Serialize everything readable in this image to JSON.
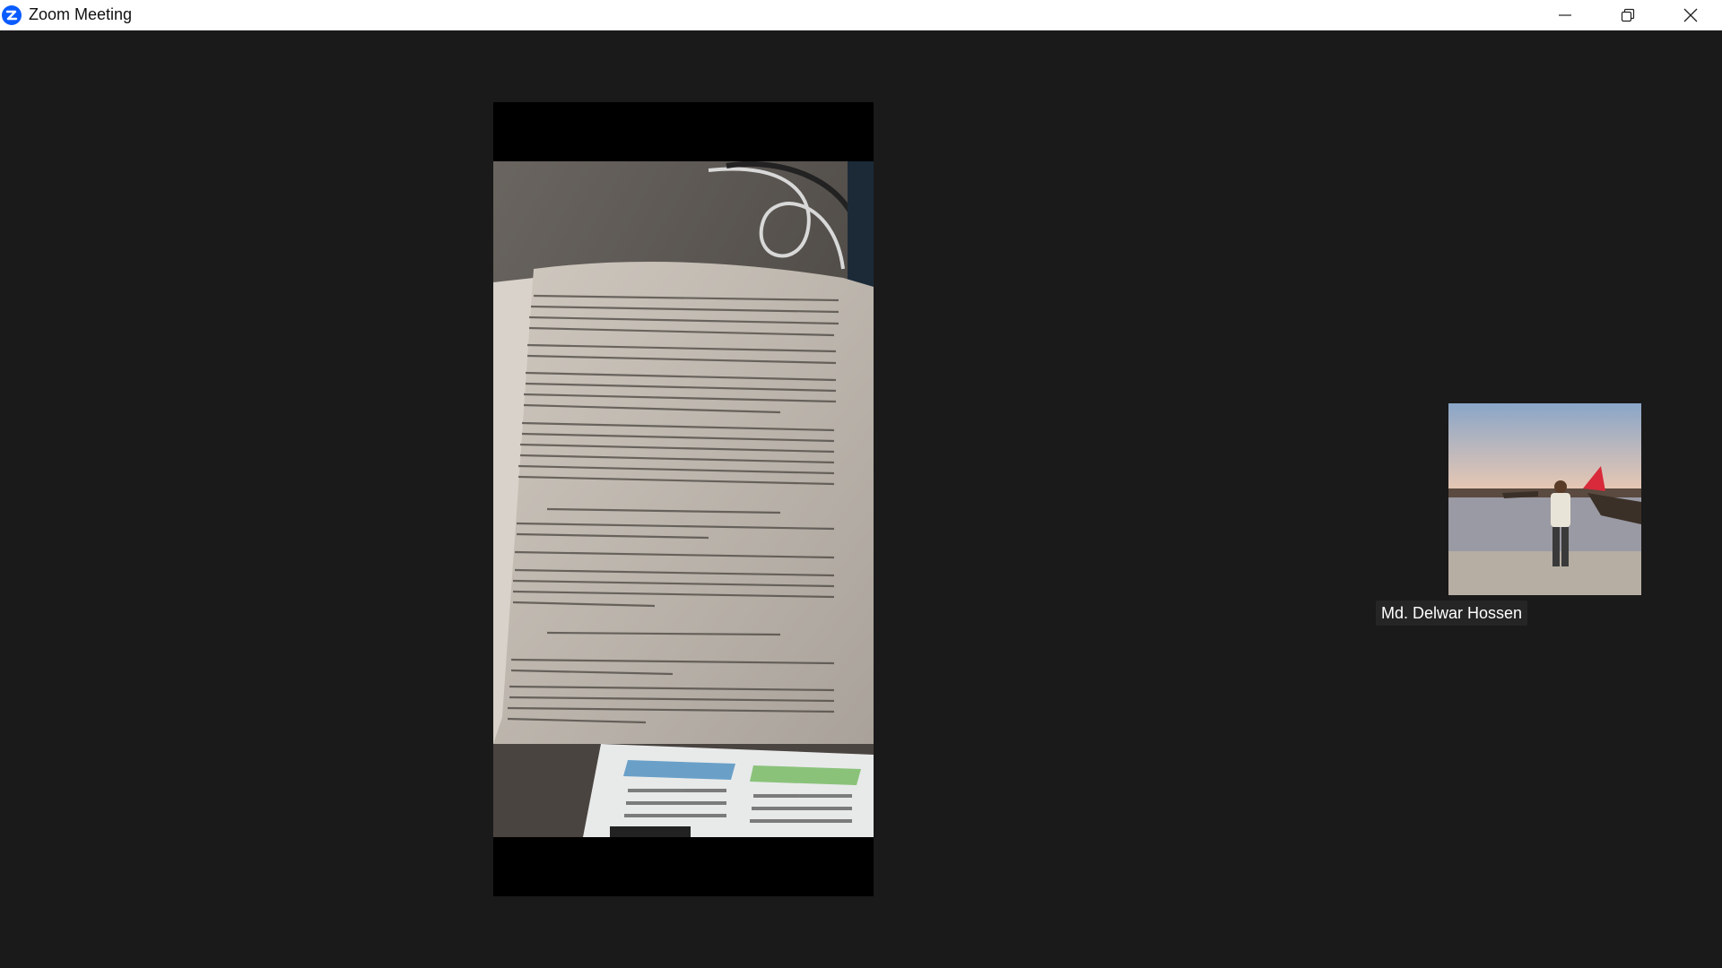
{
  "window": {
    "title": "Zoom Meeting",
    "app_icon": "zoom-logo-icon",
    "controls": [
      "minimize-icon",
      "restore-icon",
      "close-icon"
    ]
  },
  "meeting": {
    "shared_video": {
      "description_icon": "camera-feed"
    },
    "participants": [
      {
        "name": "Md. Delwar Hossen"
      }
    ]
  }
}
